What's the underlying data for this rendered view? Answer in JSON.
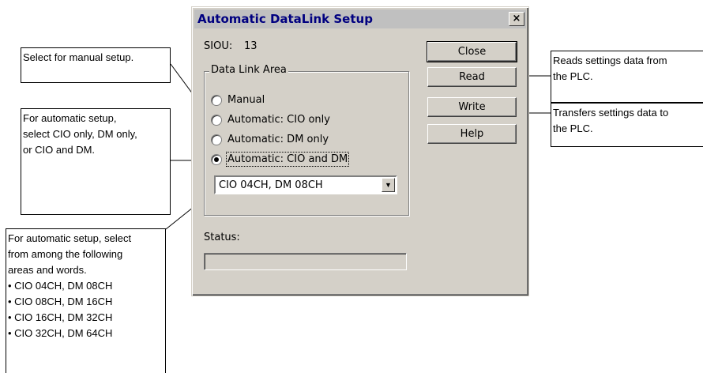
{
  "dialog": {
    "title": "Automatic DataLink Setup",
    "close_glyph": "×",
    "siou_label": "SIOU:",
    "siou_value": "13",
    "group_label": "Data Link Area",
    "radios": [
      {
        "label": "Manual",
        "checked": false
      },
      {
        "label": "Automatic: CIO only",
        "checked": false
      },
      {
        "label": "Automatic: DM only",
        "checked": false
      },
      {
        "label": "Automatic: CIO and DM",
        "checked": true
      }
    ],
    "area_select": {
      "value": "CIO 04CH, DM 08CH"
    },
    "status_label": "Status:",
    "status_value": "",
    "buttons": {
      "close": "Close",
      "read": "Read",
      "write": "Write",
      "help": "Help"
    }
  },
  "callouts": {
    "manual": "Select for manual setup.",
    "automatic_lines": [
      "For automatic setup,",
      "select CIO only, DM only,",
      "or CIO and DM."
    ],
    "areas_lines": [
      "For automatic setup, select",
      "from among the following",
      "areas and words."
    ],
    "areas_options": [
      "• CIO 04CH, DM 08CH",
      "• CIO 08CH, DM 16CH",
      "• CIO 16CH, DM 32CH",
      "• CIO 32CH, DM 64CH"
    ],
    "read_lines": [
      "Reads settings data from",
      "the PLC."
    ],
    "write_lines": [
      "Transfers settings data to",
      "the PLC."
    ]
  }
}
